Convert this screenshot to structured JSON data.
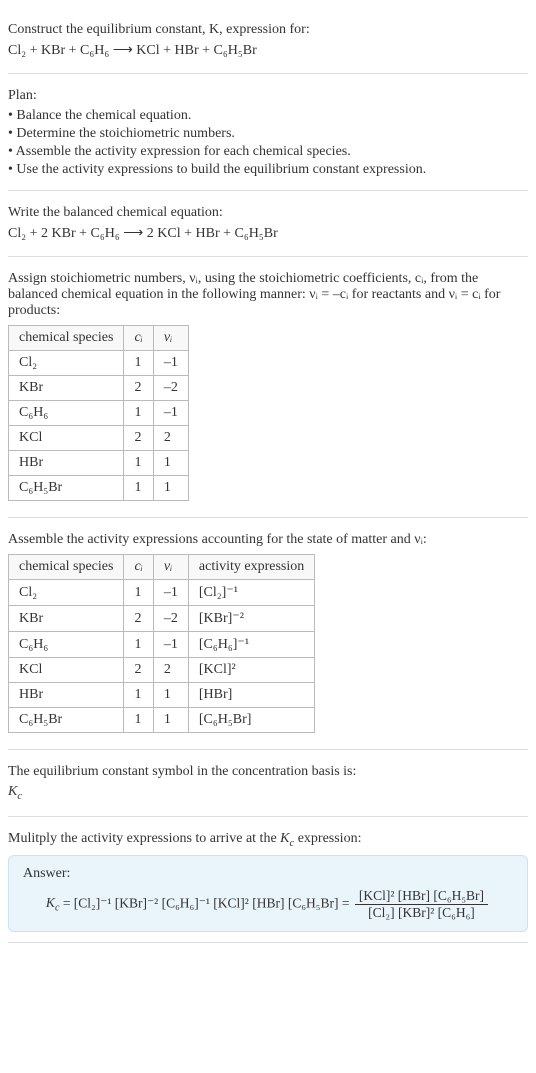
{
  "intro": {
    "line1": "Construct the equilibrium constant, K, expression for:",
    "equation": "Cl₂ + KBr + C₆H₆  ⟶  KCl + HBr + C₆H₅Br"
  },
  "plan": {
    "heading": "Plan:",
    "b1": "• Balance the chemical equation.",
    "b2": "• Determine the stoichiometric numbers.",
    "b3": "• Assemble the activity expression for each chemical species.",
    "b4": "• Use the activity expressions to build the equilibrium constant expression."
  },
  "balanced": {
    "heading": "Write the balanced chemical equation:",
    "equation": "Cl₂ + 2 KBr + C₆H₆  ⟶  2 KCl + HBr + C₆H₅Br"
  },
  "stoich": {
    "text1": "Assign stoichiometric numbers, νᵢ, using the stoichiometric coefficients, cᵢ, from the balanced chemical equation in the following manner: νᵢ = –cᵢ for reactants and νᵢ = cᵢ for products:",
    "headers": {
      "h1": "chemical species",
      "h2": "cᵢ",
      "h3": "νᵢ"
    },
    "rows": [
      {
        "sp": "Cl₂",
        "c": "1",
        "v": "–1"
      },
      {
        "sp": "KBr",
        "c": "2",
        "v": "–2"
      },
      {
        "sp": "C₆H₆",
        "c": "1",
        "v": "–1"
      },
      {
        "sp": "KCl",
        "c": "2",
        "v": "2"
      },
      {
        "sp": "HBr",
        "c": "1",
        "v": "1"
      },
      {
        "sp": "C₆H₅Br",
        "c": "1",
        "v": "1"
      }
    ]
  },
  "activity": {
    "heading": "Assemble the activity expressions accounting for the state of matter and νᵢ:",
    "headers": {
      "h1": "chemical species",
      "h2": "cᵢ",
      "h3": "νᵢ",
      "h4": "activity expression"
    },
    "rows": [
      {
        "sp": "Cl₂",
        "c": "1",
        "v": "–1",
        "a": "[Cl₂]⁻¹"
      },
      {
        "sp": "KBr",
        "c": "2",
        "v": "–2",
        "a": "[KBr]⁻²"
      },
      {
        "sp": "C₆H₆",
        "c": "1",
        "v": "–1",
        "a": "[C₆H₆]⁻¹"
      },
      {
        "sp": "KCl",
        "c": "2",
        "v": "2",
        "a": "[KCl]²"
      },
      {
        "sp": "HBr",
        "c": "1",
        "v": "1",
        "a": "[HBr]"
      },
      {
        "sp": "C₆H₅Br",
        "c": "1",
        "v": "1",
        "a": "[C₆H₅Br]"
      }
    ]
  },
  "symbol": {
    "line": "The equilibrium constant symbol in the concentration basis is:",
    "kc": "K_c"
  },
  "multiply": {
    "line": "Mulitply the activity expressions to arrive at the K_c expression:"
  },
  "answer": {
    "label": "Answer:",
    "lhs": "K_c = [Cl₂]⁻¹ [KBr]⁻² [C₆H₆]⁻¹ [KCl]² [HBr] [C₆H₅Br] = ",
    "num": "[KCl]² [HBr] [C₆H₅Br]",
    "den": "[Cl₂] [KBr]² [C₆H₆]"
  },
  "chart_data": {
    "type": "table",
    "tables": [
      {
        "title": "Stoichiometric numbers",
        "columns": [
          "chemical species",
          "c_i",
          "ν_i"
        ],
        "rows": [
          [
            "Cl2",
            1,
            -1
          ],
          [
            "KBr",
            2,
            -2
          ],
          [
            "C6H6",
            1,
            -1
          ],
          [
            "KCl",
            2,
            2
          ],
          [
            "HBr",
            1,
            1
          ],
          [
            "C6H5Br",
            1,
            1
          ]
        ]
      },
      {
        "title": "Activity expressions",
        "columns": [
          "chemical species",
          "c_i",
          "ν_i",
          "activity expression"
        ],
        "rows": [
          [
            "Cl2",
            1,
            -1,
            "[Cl2]^-1"
          ],
          [
            "KBr",
            2,
            -2,
            "[KBr]^-2"
          ],
          [
            "C6H6",
            1,
            -1,
            "[C6H6]^-1"
          ],
          [
            "KCl",
            2,
            2,
            "[KCl]^2"
          ],
          [
            "HBr",
            1,
            1,
            "[HBr]"
          ],
          [
            "C6H5Br",
            1,
            1,
            "[C6H5Br]"
          ]
        ]
      }
    ]
  }
}
